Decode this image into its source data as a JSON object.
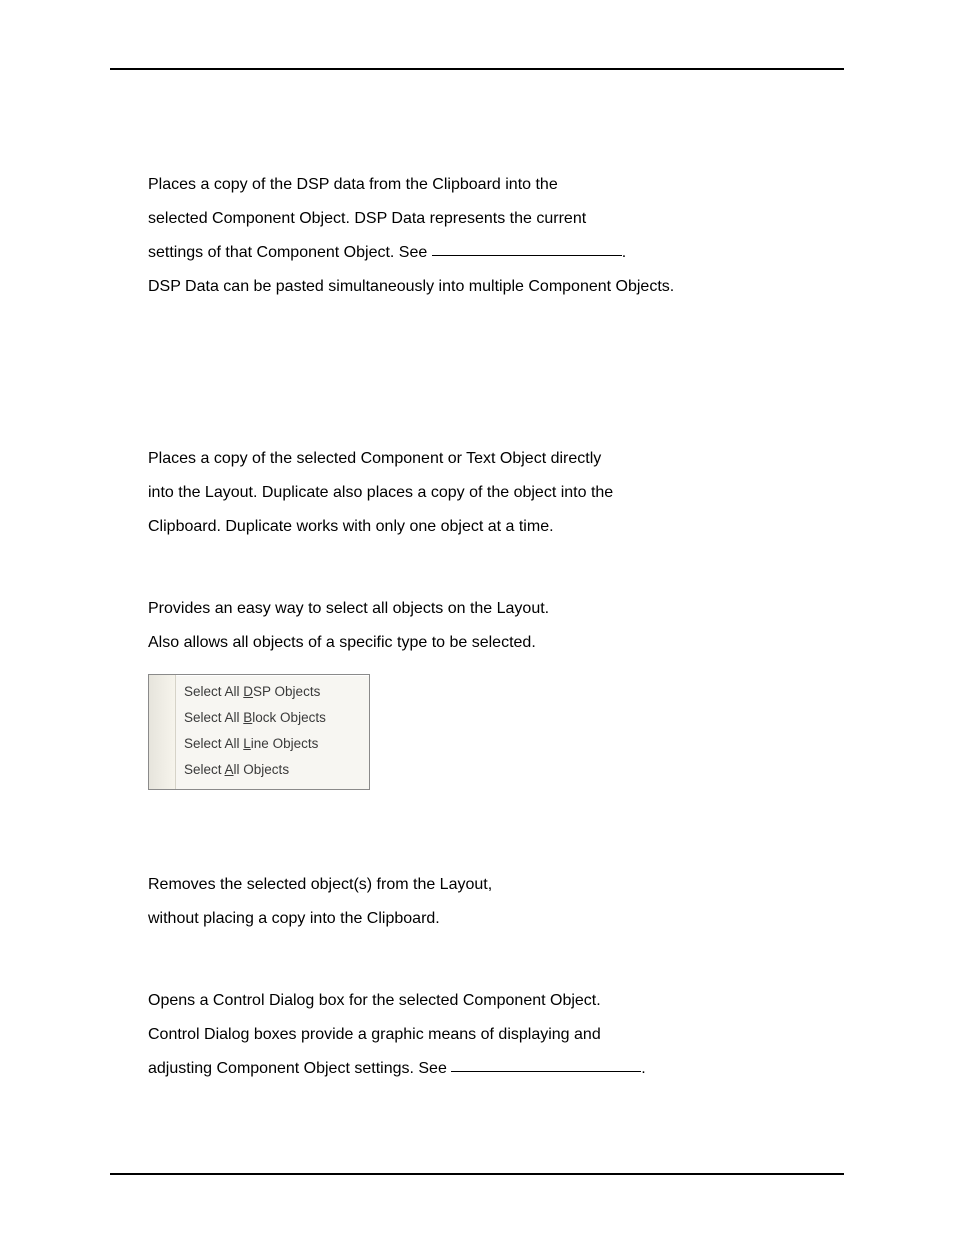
{
  "sections": {
    "pasteDsp": {
      "line1": "Places a copy of the DSP data from the Clipboard into the",
      "line2": "selected Component Object. DSP Data represents the current",
      "line3a": "settings of that Component Object. See ",
      "line3b": ".",
      "line4": "DSP Data can be pasted simultaneously into multiple Component Objects."
    },
    "duplicate": {
      "line1": "Places a copy of the selected Component or Text Object directly",
      "line2": "into the Layout. Duplicate also places a copy of the object into the",
      "line3": "Clipboard. Duplicate works with only one object at a time."
    },
    "selectAll": {
      "line1": "Provides an easy way to select all objects on the Layout.",
      "line2": "Also allows all objects of a specific type to be selected."
    },
    "menu": {
      "dsp": {
        "pre": "Select All ",
        "ul": "D",
        "post": "SP Objects"
      },
      "block": {
        "pre": "Select All ",
        "ul": "B",
        "post": "lock Objects"
      },
      "line": {
        "pre": "Select All ",
        "ul": "L",
        "post": "ine Objects"
      },
      "all": {
        "pre": "Select ",
        "ul": "A",
        "post": "ll Objects"
      }
    },
    "delete": {
      "line1": "Removes the selected object(s) from the Layout,",
      "line2": "without placing a copy into the Clipboard."
    },
    "controlDialog": {
      "line1": "Opens a Control Dialog box for the selected Component Object.",
      "line2": "Control Dialog boxes provide a graphic means of displaying and",
      "line3a": "adjusting Component Object settings. See ",
      "line3b": "."
    }
  }
}
